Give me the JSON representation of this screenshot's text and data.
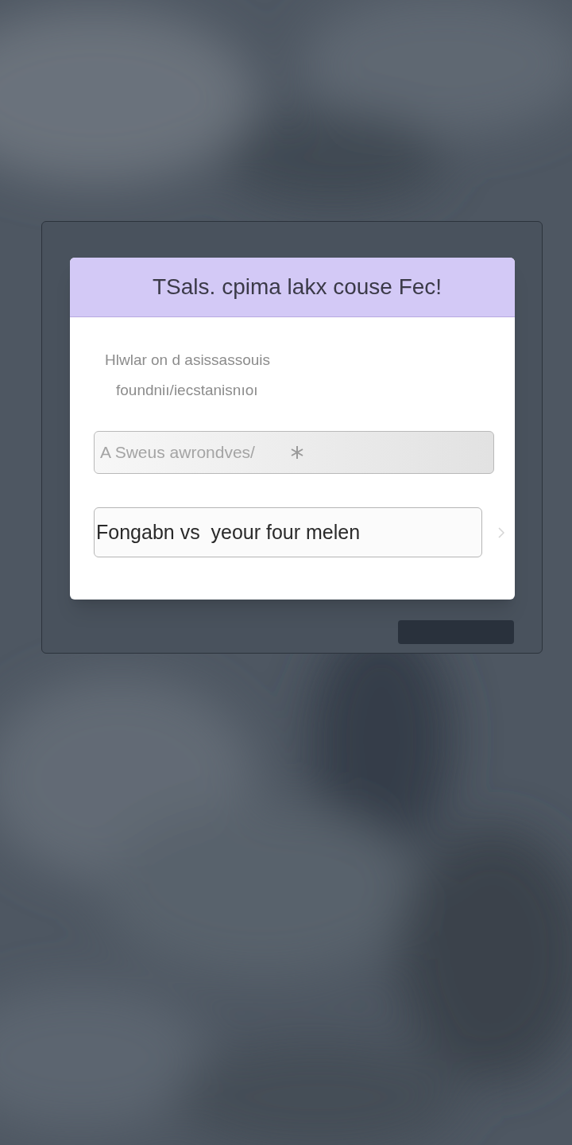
{
  "dialog": {
    "title": "TSals.  cpima lakx couse Fec!",
    "description": [
      "Hlwlar on d asissassouis",
      "foundniı/iecstanisnıoı"
    ],
    "fields": [
      {
        "kind": "hint",
        "placeholder": "A Sweus awrondves/"
      },
      {
        "kind": "filled",
        "value": "Fongabn vs  yeour four melen"
      }
    ]
  }
}
